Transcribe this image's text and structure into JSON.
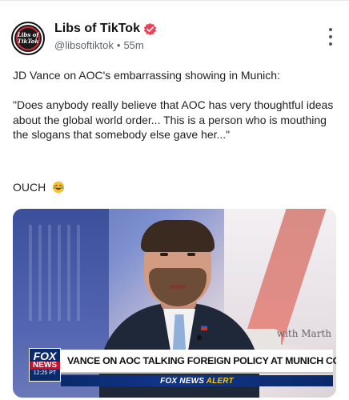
{
  "post": {
    "display_name": "Libs of TikTok",
    "handle": "@libsoftiktok",
    "separator": "•",
    "timestamp": "55m",
    "avatar_text_line1": "Libs of",
    "avatar_text_line2": "TikTok",
    "text_line1": "JD Vance on AOC's embarrassing showing in Munich:",
    "text_quote": "\"Does anybody really believe that AOC has very thoughtful ideas about the global world order... This is a person who is mouthing the slogans that somebody else gave her...\"",
    "text_closing": "OUCH",
    "closing_emoji": "rofl-emoji-icon"
  },
  "media": {
    "chyron_headline": "VANCE ON AOC TALKING FOREIGN POLICY AT MUNICH CONF",
    "network_logo_top": "FOX",
    "network_logo_bottom": "NEWS",
    "network_time": "12:25 PT",
    "alert_prefix": "FOX NEWS",
    "alert_word": "ALERT",
    "watermark": "with Marth"
  },
  "colors": {
    "verified_badge": "#e8425a",
    "fox_blue": "#0b2a6b",
    "fox_red": "#c8102e"
  }
}
